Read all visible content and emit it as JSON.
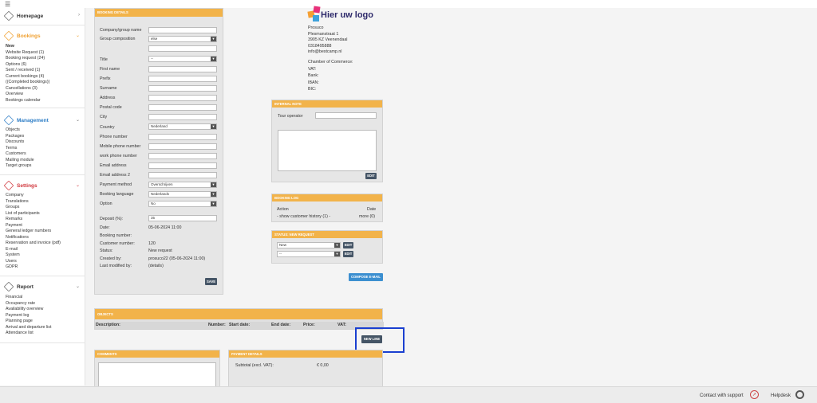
{
  "sidebar": {
    "homepage": "Homepage",
    "bookings": {
      "title": "Bookings",
      "items": [
        "New",
        "Website Request (1)",
        "Booking request (24)",
        "Options (6)",
        "Sent / received (1)",
        "Current bookings (4)",
        "((Completed bookings))",
        "Cancellations (3)",
        "Overview",
        "Bookings calendar"
      ]
    },
    "management": {
      "title": "Management",
      "items": [
        "Objects",
        "Packages",
        "Discounts",
        "Terms",
        "Customers",
        "Mailing module",
        "Target groups"
      ]
    },
    "settings": {
      "title": "Settings",
      "items": [
        "Company",
        "Translations",
        "Groups",
        "List of participants",
        "Remarks",
        "Payment",
        "General ledger numbers",
        "Notifications",
        "Reservation and invoice (pdf)",
        "E-mail",
        "System",
        "Users",
        "GDPR"
      ]
    },
    "report": {
      "title": "Report",
      "items": [
        "Financial",
        "Occupancy rate",
        "Availability overview",
        "Payment log",
        "Planning page",
        "Arrival and departure list",
        "Attendance list"
      ]
    }
  },
  "booking_details": {
    "header": "BOOKING DETAILS",
    "fields": {
      "company": "Company/group name",
      "group_composition": "Group composition",
      "group_composition_value": "else",
      "title": "Title",
      "title_value": "--",
      "first_name": "First name",
      "prefix": "Prefix",
      "surname": "Surname",
      "address": "Address",
      "postal_code": "Postal code",
      "city": "City",
      "country": "Country",
      "country_value": "Nederland",
      "phone": "Phone number",
      "mobile": "Mobile phone number",
      "work_phone": "work phone number",
      "email": "Email address",
      "email2": "Email address 2",
      "payment_method": "Payment method",
      "payment_method_value": "Overschrijven",
      "booking_language": "Booking language",
      "booking_language_value": "Nederlands",
      "option": "Option",
      "option_value": "No",
      "deposit": "Deposit (%):",
      "deposit_value": "35"
    },
    "info": {
      "date_label": "Date:",
      "date_value": "05-06-2024 11:00",
      "booking_number_label": "Booking number:",
      "booking_number_value": "",
      "customer_number_label": "Customer number:",
      "customer_number_value": "120",
      "status_label": "Status:",
      "status_value": "New request",
      "created_by_label": "Created by:",
      "created_by_value": "prosuco22 (05-06-2024 11:00)",
      "last_modified_label": "Last modified by:",
      "last_modified_value": "(details)"
    },
    "save": "SAVE"
  },
  "company_info": {
    "logo_text": "Hier uw logo",
    "lines": [
      "Prosuco",
      "Plesmanstraat 1",
      "3905 KZ Veenendaal",
      "0318495888",
      "info@bestcamp.nl"
    ],
    "extra_lines": [
      "Chamber of Commerce:",
      "VAT:",
      "Bank:",
      "IBAN:",
      "BIC:"
    ]
  },
  "internal_note": {
    "header": "INTERNAL NOTE",
    "tour_operator": "Tour operator",
    "edit": "EDIT"
  },
  "booking_log": {
    "header": "BOOKING LOG",
    "action": "Action",
    "date": "Date",
    "history": "- show customer history (1) -",
    "more": "more (0)"
  },
  "status": {
    "header": "STATUS: NEW REQUEST",
    "select1": "New",
    "select2": "--",
    "edit": "EDIT"
  },
  "compose_email": "COMPOSE E-MAIL",
  "objects": {
    "header": "OBJECTS",
    "columns": [
      "Description:",
      "Number:",
      "Start date:",
      "End date:",
      "Price:",
      "VAT:"
    ],
    "new_line": "NEW LINE"
  },
  "comments": {
    "header": "COMMENTS"
  },
  "payment_details": {
    "header": "PAYMENT DETAILS",
    "subtotal_label": "Subtotal (excl. VAT):",
    "subtotal_value": "€ 0,00"
  },
  "footer": {
    "support": "Contact with support",
    "helpdesk": "Helpdesk"
  },
  "colors": {
    "panel_header": "#f2b34a",
    "bookings_accent": "#f0a030",
    "management_accent": "#2d7dc6",
    "settings_accent": "#d0363c",
    "highlight": "#1a3fd0"
  }
}
